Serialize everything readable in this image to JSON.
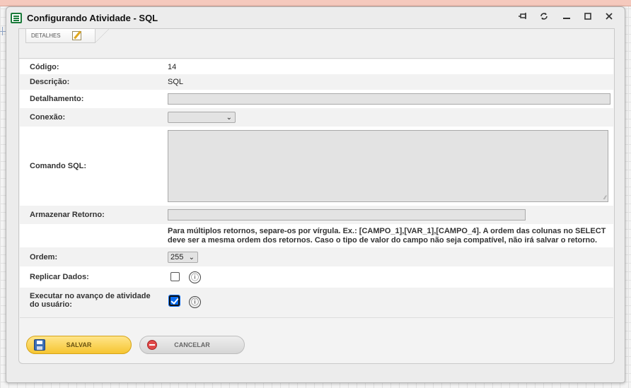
{
  "window": {
    "title": "Configurando Atividade - SQL",
    "controls": [
      "pin-icon",
      "refresh-icon",
      "minimize-icon",
      "maximize-icon",
      "close-icon"
    ]
  },
  "tabs": [
    {
      "label": "DETALHES",
      "icon": "edit-icon",
      "active": true
    }
  ],
  "form": {
    "codigo": {
      "label": "Código:",
      "value": "14"
    },
    "descricao": {
      "label": "Descrição:",
      "value": "SQL"
    },
    "detalhamento": {
      "label": "Detalhamento:",
      "value": ""
    },
    "conexao": {
      "label": "Conexão:",
      "value": ""
    },
    "comando_sql": {
      "label": "Comando SQL:",
      "value": ""
    },
    "armazenar_retorno": {
      "label": "Armazenar Retorno:",
      "value": ""
    },
    "help_text": "Para múltiplos retornos, separe-os por vírgula. Ex.: [CAMPO_1],[VAR_1],[CAMPO_4]. A ordem das colunas no SELECT deve ser a mesma ordem dos retornos. Caso o tipo de valor do campo não seja compatível, não irá salvar o retorno.",
    "ordem": {
      "label": "Ordem:",
      "value": "255"
    },
    "replicar_dados": {
      "label": "Replicar Dados:",
      "checked": false,
      "info_icon": "ⓘ"
    },
    "executar_avanco": {
      "label_line1": "Executar no avanço de atividade",
      "label_line2": "do usuário:",
      "checked": true,
      "info_icon": "ⓘ"
    }
  },
  "buttons": {
    "save": "SALVAR",
    "cancel": "CANCELAR"
  },
  "colors": {
    "save_button": "#f6c531",
    "check_on": "#0a6cf0",
    "title_icon": "#1a7a3a"
  }
}
